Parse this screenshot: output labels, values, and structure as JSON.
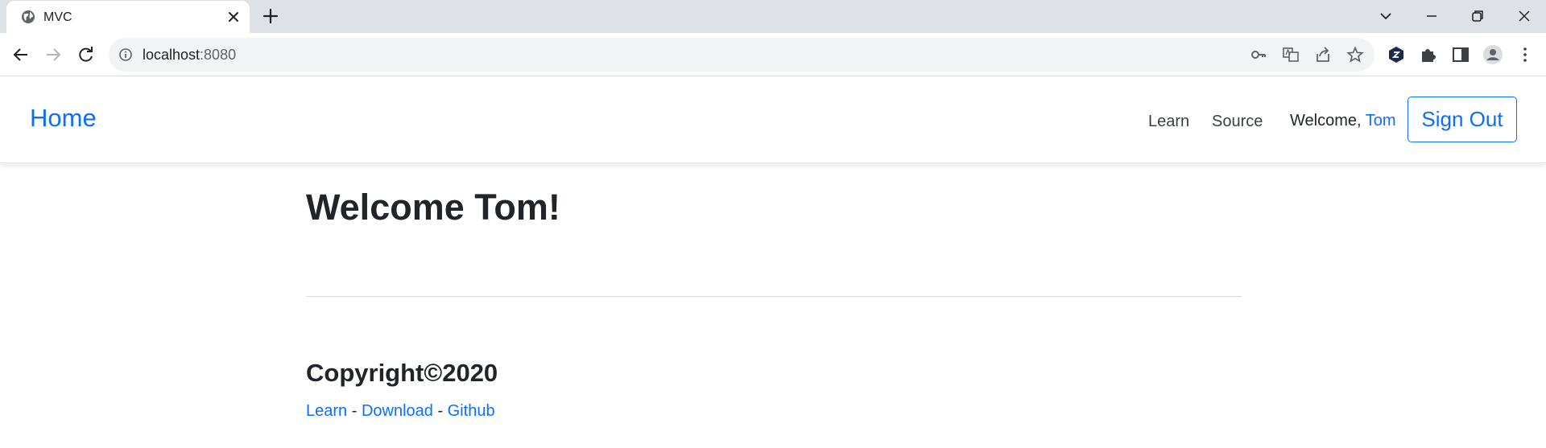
{
  "browser": {
    "tab": {
      "title": "MVC"
    },
    "address": {
      "host": "localhost",
      "port": ":8080"
    }
  },
  "navbar": {
    "brand": "Home",
    "links": [
      "Learn",
      "Source"
    ],
    "welcome_prefix": "Welcome, ",
    "user_name": "Tom",
    "signout_label": "Sign Out"
  },
  "main": {
    "heading": "Welcome Tom!"
  },
  "footer": {
    "copyright": "Copyright©2020",
    "links": [
      "Learn",
      "Download",
      "Github"
    ],
    "separator": " - "
  },
  "colors": {
    "link": "#0d6efd",
    "text": "#212529",
    "chrome_bg": "#dee1e6",
    "omnibox_bg": "#f1f3f4"
  }
}
